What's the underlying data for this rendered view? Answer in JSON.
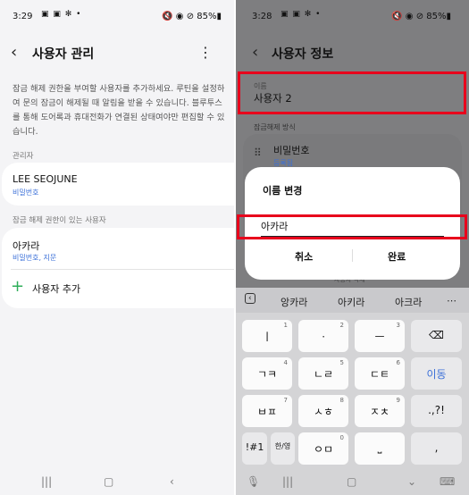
{
  "left": {
    "status": {
      "time": "3:29",
      "icons": "▣ ▣ ✻ •",
      "right": "🔇 ◉ ⊘ 85%▮"
    },
    "title": "사용자 관리",
    "description": "잠금 해제 권한을 부여할 사용자를 추가하세요. 루틴을 설정하여 문의 잠금이 해제될 때 알림을 받을 수 있습니다. 블루투스를 통해 도어록과 휴대전화가 연결된 상태여야만 편집할 수 있습니다.",
    "admin_section": "관리자",
    "admin_name": "LEE SEOJUNE",
    "admin_method": "비밀번호",
    "users_section": "잠금 해제 권한이 있는 사용자",
    "user_name": "아카라",
    "user_method": "비밀번호, 지문",
    "add_user": "사용자 추가"
  },
  "right": {
    "status": {
      "time": "3:28",
      "icons": "▣ ▣ ✻ •",
      "right": "🔇 ◉ ⊘ 85%▮"
    },
    "title": "사용자 정보",
    "name_label": "이름",
    "name_value": "사용자 2",
    "unlock_section": "잠금해제 방식",
    "password_label": "비밀번호",
    "password_status": "등록됨",
    "delete_user": "사용자 삭제",
    "dialog": {
      "title": "이름 변경",
      "input_value": "아카라",
      "cancel": "취소",
      "done": "완료"
    },
    "suggestions": [
      "앙카라",
      "아키라",
      "아크라"
    ],
    "keys": [
      {
        "label": "ㅣ",
        "sup": "1"
      },
      {
        "label": "ㆍ",
        "sup": "2"
      },
      {
        "label": "ㅡ",
        "sup": "3"
      },
      {
        "label": "ㄱㅋ",
        "sup": "4"
      },
      {
        "label": "ㄴㄹ",
        "sup": "5"
      },
      {
        "label": "ㄷㅌ",
        "sup": "6"
      },
      {
        "label": "ㅂㅍ",
        "sup": "7"
      },
      {
        "label": "ㅅㅎ",
        "sup": "8"
      },
      {
        "label": "ㅈㅊ",
        "sup": "9"
      },
      {
        "label": "ㅇㅁ",
        "sup": "0"
      }
    ],
    "key_move": "이동",
    "key_punct": ".,?!",
    "key_symbols": "!#1",
    "key_lang": "한/영",
    "key_comma": ","
  }
}
